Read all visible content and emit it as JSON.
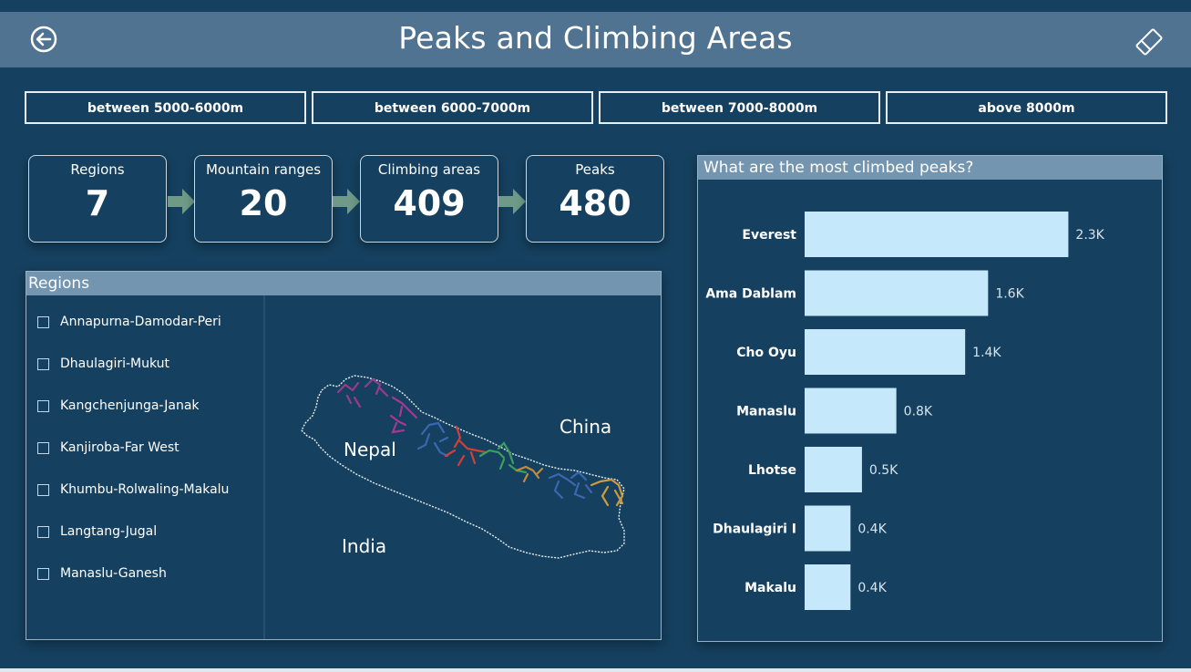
{
  "header": {
    "title": "Peaks and Climbing Areas",
    "back_icon": "back-arrow-icon",
    "clear_icon": "eraser-icon"
  },
  "filters": [
    {
      "label": "between 5000-6000m"
    },
    {
      "label": "between 6000-7000m"
    },
    {
      "label": "between 7000-8000m"
    },
    {
      "label": "above 8000m"
    }
  ],
  "kpis": [
    {
      "label": "Regions",
      "value": "7"
    },
    {
      "label": "Mountain ranges",
      "value": "20"
    },
    {
      "label": "Climbing areas",
      "value": "409"
    },
    {
      "label": "Peaks",
      "value": "480"
    }
  ],
  "regions": {
    "title": "Regions",
    "items": [
      {
        "label": "Annapurna-Damodar-Peri",
        "checked": false
      },
      {
        "label": "Dhaulagiri-Mukut",
        "checked": false
      },
      {
        "label": "Kangchenjunga-Janak",
        "checked": false
      },
      {
        "label": "Kanjiroba-Far West",
        "checked": false
      },
      {
        "label": "Khumbu-Rolwaling-Makalu",
        "checked": false
      },
      {
        "label": "Langtang-Jugal",
        "checked": false
      },
      {
        "label": "Manaslu-Ganesh",
        "checked": false
      }
    ],
    "map_labels": {
      "nepal": "Nepal",
      "china": "China",
      "india": "India"
    }
  },
  "colors": {
    "background": "#15405f",
    "header": "#4f7391",
    "panel_head": "#7395b0",
    "bar": "#c5e9fb",
    "arrow": "#6f9a88"
  },
  "chart_data": {
    "type": "bar",
    "orientation": "horizontal",
    "title": "What are the most climbed peaks?",
    "categories": [
      "Everest",
      "Ama Dablam",
      "Cho Oyu",
      "Manaslu",
      "Lhotse",
      "Dhaulagiri I",
      "Makalu"
    ],
    "values": [
      2300,
      1600,
      1400,
      800,
      500,
      400,
      400
    ],
    "value_labels": [
      "2.3K",
      "1.6K",
      "1.4K",
      "0.8K",
      "0.5K",
      "0.4K",
      "0.4K"
    ],
    "xlim": [
      0,
      2400
    ],
    "grid": false,
    "legend": "none"
  }
}
